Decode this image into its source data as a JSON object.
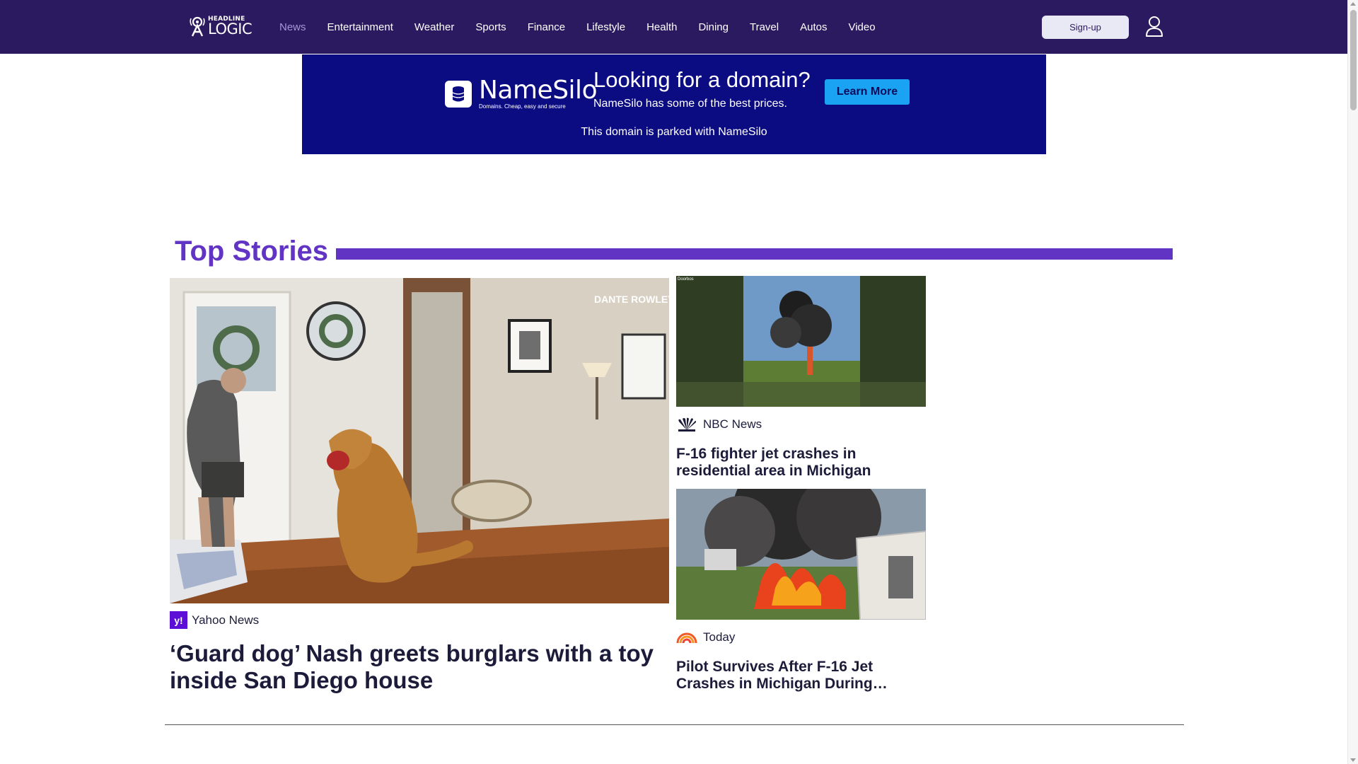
{
  "logo": {
    "top": "HEADLINE",
    "bottom": "LOGIC"
  },
  "nav": [
    {
      "label": "News",
      "active": true
    },
    {
      "label": "Entertainment",
      "active": false
    },
    {
      "label": "Weather",
      "active": false
    },
    {
      "label": "Sports",
      "active": false
    },
    {
      "label": "Finance",
      "active": false
    },
    {
      "label": "Lifestyle",
      "active": false
    },
    {
      "label": "Health",
      "active": false
    },
    {
      "label": "Dining",
      "active": false
    },
    {
      "label": "Travel",
      "active": false
    },
    {
      "label": "Autos",
      "active": false
    },
    {
      "label": "Video",
      "active": false
    }
  ],
  "header": {
    "signup_label": "Sign-up",
    "user_icon": "user-icon"
  },
  "ad": {
    "brand": "NameSilo",
    "tagline": "Domains. Cheap, easy and secure",
    "headline": "Looking for a domain?",
    "subtext": "NameSilo has some of the best prices.",
    "button_label": "Learn More",
    "footer": "This domain is parked with NameSilo"
  },
  "section": {
    "title": "Top Stories"
  },
  "stories": {
    "main": {
      "image_caption": "DANTE ROWLEY",
      "source": "Yahoo News",
      "source_icon": "yahoo-icon",
      "headline": "‘Guard dog’ Nash greets burglars with a toy inside San Diego house"
    },
    "side": [
      {
        "image_caption": "Doorbos",
        "source": "NBC News",
        "source_icon": "nbc-peacock-icon",
        "headline": "F-16 fighter jet crashes in residential area in Michigan"
      },
      {
        "source": "Today",
        "source_icon": "today-rainbow-icon",
        "headline": "Pilot Survives After F-16 Jet Crashes in Michigan During…"
      }
    ]
  },
  "colors": {
    "header_bg": "#2b1a5f",
    "accent": "#6234c4",
    "ad_bg": "#0b0b82",
    "ad_button": "#1aa3f2",
    "nav_active": "#a996d8"
  }
}
